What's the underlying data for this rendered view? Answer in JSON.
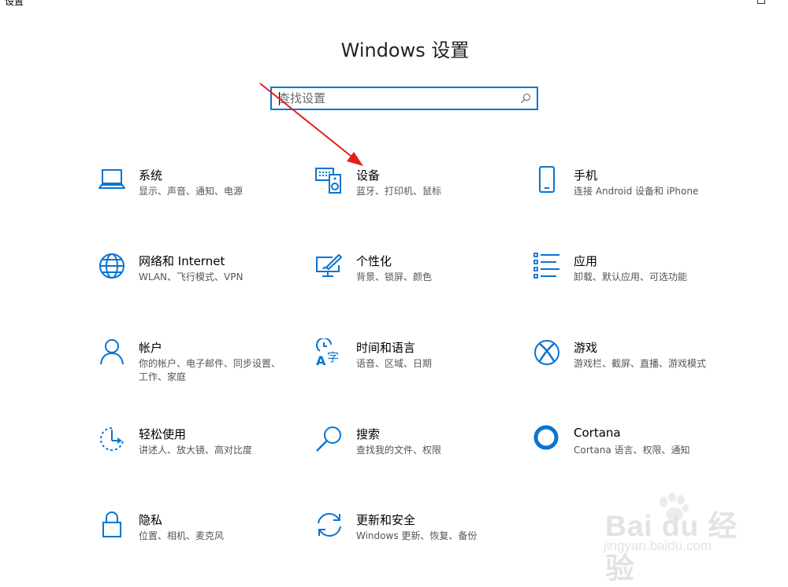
{
  "window": {
    "app_title": "设置",
    "minimize_glyph": "–",
    "maximize_icon": "maximize-icon"
  },
  "page": {
    "title": "Windows 设置"
  },
  "search": {
    "placeholder": "查找设置",
    "icon": "search-icon"
  },
  "annotation": {
    "arrow_color": "#e0201e"
  },
  "accent_color": "#0a74d0",
  "categories": [
    {
      "name": "系统",
      "desc": "显示、声音、通知、电源",
      "icon": "laptop-icon"
    },
    {
      "name": "设备",
      "desc": "蓝牙、打印机、鼠标",
      "icon": "devices-icon"
    },
    {
      "name": "手机",
      "desc": "连接 Android 设备和 iPhone",
      "icon": "phone-icon"
    },
    {
      "name": "网络和 Internet",
      "desc": "WLAN、飞行模式、VPN",
      "icon": "globe-icon"
    },
    {
      "name": "个性化",
      "desc": "背景、锁屏、颜色",
      "icon": "personalization-icon"
    },
    {
      "name": "应用",
      "desc": "卸载、默认应用、可选功能",
      "icon": "apps-list-icon"
    },
    {
      "name": "帐户",
      "desc": "你的帐户、电子邮件、同步设置、工作、家庭",
      "icon": "person-icon"
    },
    {
      "name": "时间和语言",
      "desc": "语音、区域、日期",
      "icon": "time-language-icon"
    },
    {
      "name": "游戏",
      "desc": "游戏栏、截屏、直播、游戏模式",
      "icon": "xbox-icon"
    },
    {
      "name": "轻松使用",
      "desc": "讲述人、放大镜、高对比度",
      "icon": "ease-of-access-icon"
    },
    {
      "name": "搜索",
      "desc": "查找我的文件、权限",
      "icon": "magnifier-icon"
    },
    {
      "name": "Cortana",
      "desc": "Cortana 语言、权限、通知",
      "icon": "cortana-icon"
    },
    {
      "name": "隐私",
      "desc": "位置、相机、麦克风",
      "icon": "lock-icon"
    },
    {
      "name": "更新和安全",
      "desc": "Windows 更新、恢复、备份",
      "icon": "sync-icon"
    }
  ],
  "watermark": {
    "main": "Bai du 经验",
    "sub": "jingyan.baidu.com"
  }
}
